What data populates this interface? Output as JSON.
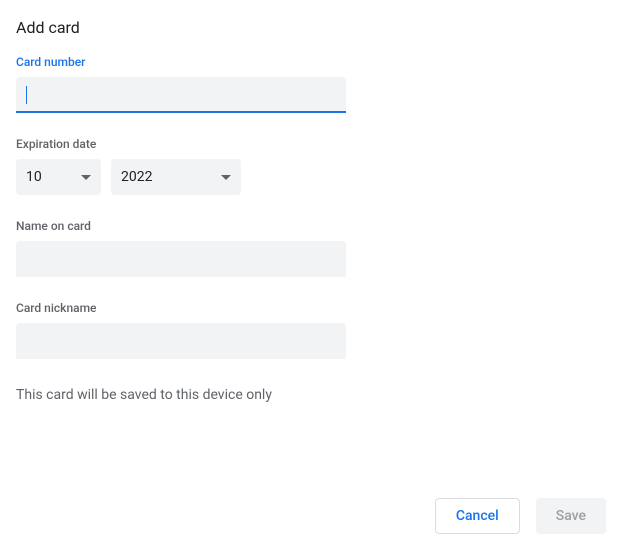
{
  "title": "Add card",
  "fields": {
    "card_number": {
      "label": "Card number",
      "value": ""
    },
    "expiration": {
      "label": "Expiration date",
      "month": "10",
      "year": "2022"
    },
    "name_on_card": {
      "label": "Name on card",
      "value": ""
    },
    "nickname": {
      "label": "Card nickname",
      "value": ""
    }
  },
  "info_text": "This card will be saved to this device only",
  "buttons": {
    "cancel": "Cancel",
    "save": "Save"
  }
}
